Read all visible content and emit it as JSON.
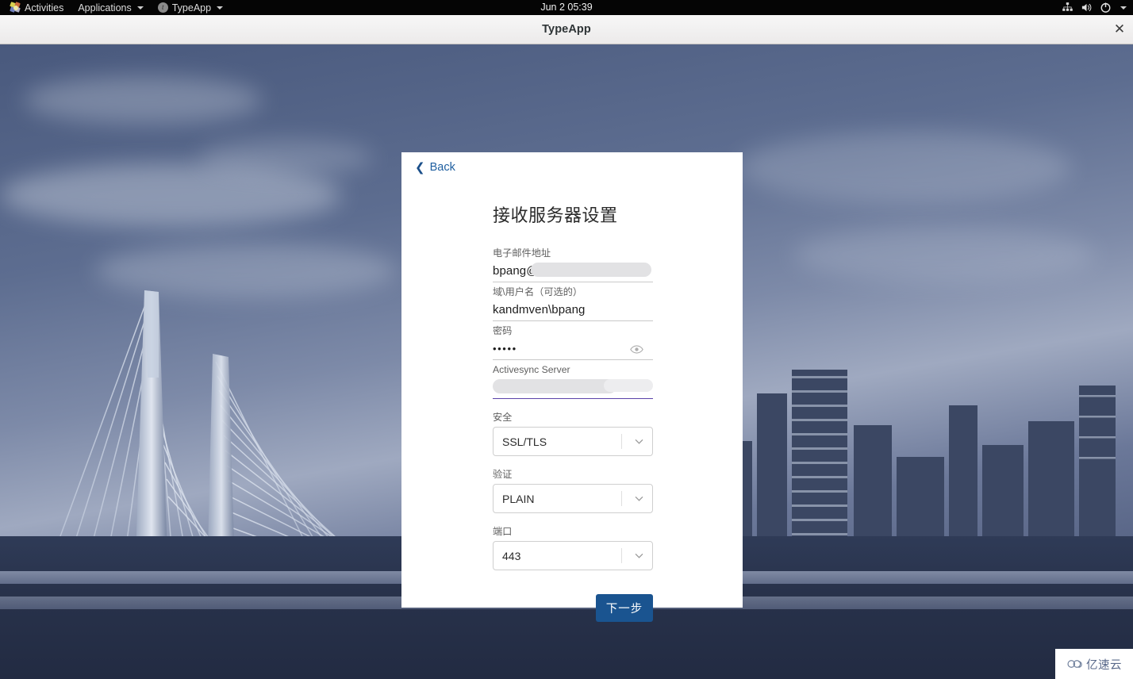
{
  "desktop": {
    "topbar": {
      "activities_label": "Activities",
      "applications_label": "Applications",
      "app_menu_label": "TypeApp",
      "clock": "Jun 2  05:39",
      "tray_icons": [
        "network-icon",
        "volume-icon",
        "power-icon",
        "chevron-down-icon"
      ],
      "logo_icon": "opensuse-logo-icon",
      "app_badge_letter": "t"
    }
  },
  "window": {
    "title": "TypeApp",
    "close_label": "✕"
  },
  "card": {
    "back_label": "Back",
    "back_icon": "chevron-left-icon",
    "title": "接收服务器设置",
    "fields": [
      {
        "name": "email",
        "label": "电子邮件地址",
        "value": "bpang@",
        "redacted": true,
        "focused": false
      },
      {
        "name": "domain-username",
        "label": "域\\用户名（可选的）",
        "value": "kandmven\\bpang",
        "redacted": false,
        "focused": false
      },
      {
        "name": "password",
        "label": "密码",
        "value": "•••••",
        "redacted": false,
        "focused": false,
        "trailing_icon": "eye-icon"
      },
      {
        "name": "activesync-server",
        "label": "Activesync Server",
        "value": "",
        "redacted": true,
        "focused": true
      }
    ],
    "selects": [
      {
        "name": "security",
        "label": "安全",
        "value": "SSL/TLS"
      },
      {
        "name": "authentication",
        "label": "验证",
        "value": "PLAIN"
      },
      {
        "name": "port",
        "label": "端口",
        "value": "443"
      }
    ],
    "submit_label": "下一步"
  },
  "watermark": {
    "text": "亿速云",
    "icon": "cloud-icon"
  },
  "colors": {
    "accent_button": "#1a5490",
    "link": "#1f5fa0",
    "focus_underline": "#5a42a8",
    "card_background": "#ffffff",
    "topbar_background": "#050505"
  }
}
